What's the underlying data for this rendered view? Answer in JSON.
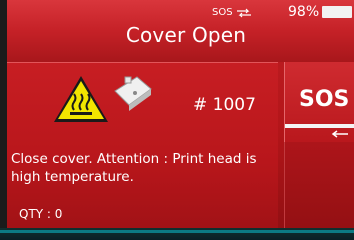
{
  "status_bar": {
    "sos_label": "SOS",
    "battery_percent": "98%"
  },
  "header": {
    "title": "Cover Open"
  },
  "alert": {
    "job_number": "# 1007",
    "message": "Close cover. Attention : Print head is high temperature.",
    "qty": "QTY : 0",
    "icons": [
      "hot-surface-warning-icon",
      "printer-device-icon"
    ]
  },
  "sidebar": {
    "sos_button_label": "SOS",
    "back_icon": "back-arrow-icon"
  },
  "colors": {
    "alert_red": "#c11f24",
    "text": "#ffffff",
    "warning_yellow": "#f2e600",
    "accent_cyan": "#0c7a84"
  }
}
